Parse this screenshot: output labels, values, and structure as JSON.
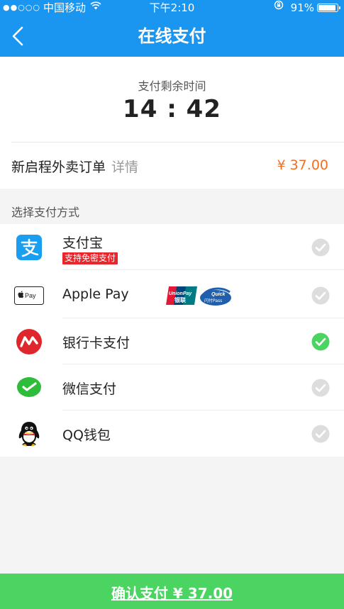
{
  "status_bar": {
    "signal_dots": "●●○○○",
    "carrier": "中国移动",
    "time": "下午2:10",
    "battery_percent": "91%",
    "battery_level": 0.91
  },
  "nav": {
    "title": "在线支付"
  },
  "timer": {
    "label": "支付剩余时间",
    "value": "14 : 42"
  },
  "order": {
    "name": "新启程外卖订单",
    "detail_link": "详情",
    "amount": "¥ 37.00"
  },
  "payment": {
    "section_label": "选择支付方式",
    "methods": [
      {
        "name": "支付宝",
        "badge": "支持免密支付",
        "icon": "alipay-icon",
        "selected": false
      },
      {
        "name": "Apple Pay",
        "icon": "apple-pay-icon",
        "selected": false
      },
      {
        "name": "银行卡支付",
        "icon": "bank-card-icon",
        "selected": true
      },
      {
        "name": "微信支付",
        "icon": "wechat-pay-icon",
        "selected": false
      },
      {
        "name": "QQ钱包",
        "icon": "qq-wallet-icon",
        "selected": false
      }
    ]
  },
  "confirm_button": {
    "label": "确认支付 ¥ 37.00"
  },
  "colors": {
    "nav_blue": "#1a95f0",
    "accent_orange": "#f26f21",
    "confirm_green": "#4cd463",
    "selected_check": "#4cd463",
    "unselected_check": "#dddddd"
  }
}
